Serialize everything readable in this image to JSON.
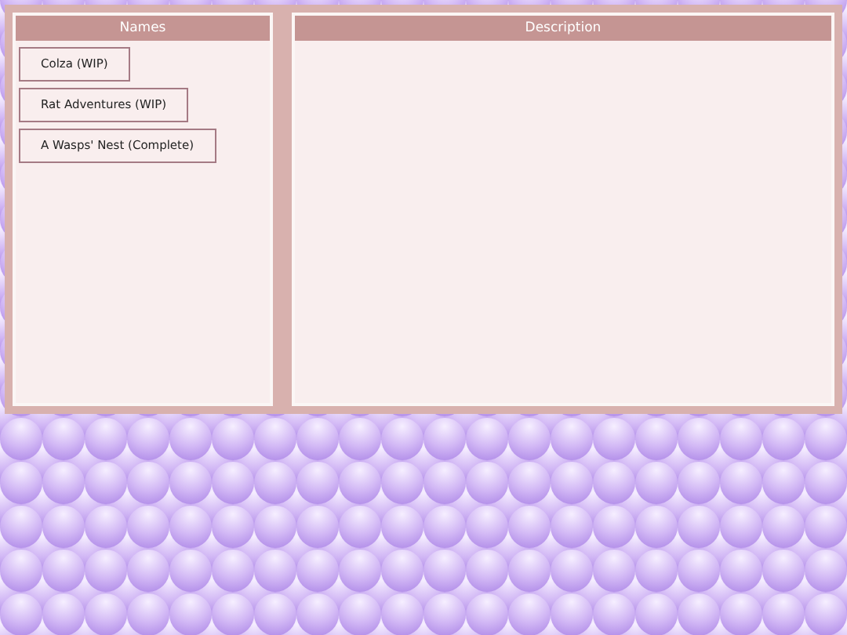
{
  "names_panel": {
    "title": "Names",
    "items": [
      {
        "label": "Colza (WIP)"
      },
      {
        "label": "Rat Adventures (WIP)"
      },
      {
        "label": "A Wasps' Nest (Complete)"
      }
    ]
  },
  "description_panel": {
    "title": "Description"
  }
}
